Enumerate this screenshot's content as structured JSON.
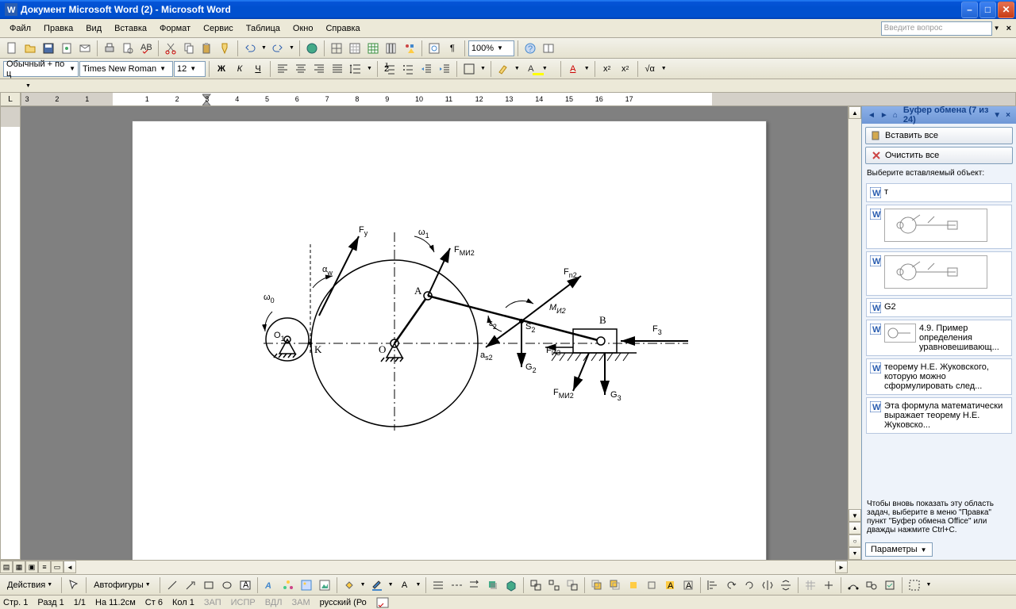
{
  "titlebar": {
    "title": "Документ Microsoft Word (2) - Microsoft Word"
  },
  "menu": {
    "file": "Файл",
    "edit": "Правка",
    "view": "Вид",
    "insert": "Вставка",
    "format": "Формат",
    "tools": "Сервис",
    "table": "Таблица",
    "window": "Окно",
    "help": "Справка",
    "ask_placeholder": "Введите вопрос"
  },
  "toolbar1": {
    "zoom": "100%"
  },
  "toolbar2": {
    "style": "Обычный + по ц",
    "font": "Times New Roman",
    "size": "12"
  },
  "taskpane": {
    "title": "Буфер обмена (7 из 24)",
    "paste_all": "Вставить все",
    "clear_all": "Очистить все",
    "choose_label": "Выберите вставляемый объект:",
    "items": [
      {
        "type": "text",
        "text": "т"
      },
      {
        "type": "thumb"
      },
      {
        "type": "thumb"
      },
      {
        "type": "text",
        "text": "G2"
      },
      {
        "type": "text_thumb",
        "text": "4.9. Пример определения уравновешивающ..."
      },
      {
        "type": "text",
        "text": "теорему Н.Е. Жуковского, которую можно сформулировать след..."
      },
      {
        "type": "text",
        "text": "Эта формула математически выражает теорему Н.Е. Жуковско..."
      }
    ],
    "footer_text": "Чтобы вновь показать эту область задач, выберите в меню \"Правка\" пункт \"Буфер обмена Office\" или дважды нажмите Ctrl+C.",
    "options": "Параметры"
  },
  "drawbar": {
    "actions": "Действия",
    "autoshapes": "Автофигуры"
  },
  "statusbar": {
    "page": "Стр. 1",
    "section": "Разд 1",
    "pages": "1/1",
    "at": "На 11.2см",
    "line": "Ст 6",
    "col": "Кол 1",
    "rec": "ЗАП",
    "trk": "ИСПР",
    "ext": "ВДЛ",
    "ovr": "ЗАМ",
    "lang": "русский (Ро"
  },
  "ruler": {
    "marks": [
      "3",
      "2",
      "1",
      "",
      "1",
      "2",
      "3",
      "4",
      "5",
      "6",
      "7",
      "8",
      "9",
      "10",
      "11",
      "12",
      "13",
      "14",
      "15",
      "16",
      "17"
    ]
  },
  "diagram": {
    "labels": {
      "Fy": "F",
      "Fy_sub": "y",
      "omega1": "ω",
      "omega1_sub": "1",
      "FMI2_top": "F",
      "FMI2_top_sub": "MИ2",
      "alpha_w": "α",
      "alpha_w_sub": "w",
      "omega0": "ω",
      "omega0_sub": "0",
      "A": "A",
      "Fn2": "F",
      "Fn2_sub": "n2",
      "MI2": "M",
      "MI2_sub": "И2",
      "MI2_italic": true,
      "O1": "O",
      "O1_sub": "1",
      "K": "K",
      "O": "O",
      "S2": "S",
      "S2_sub": "2",
      "eps2": "ε",
      "eps2_sub": "2",
      "B": "B",
      "F3": "F",
      "F3_sub": "3",
      "FI3": "F",
      "FI3_sub": "И3",
      "as2": "a",
      "as2_sub": "s2",
      "G2": "G",
      "G2_sub": "2",
      "FMI2_bot": "F",
      "FMI2_bot_sub": "MИ2",
      "G3": "G",
      "G3_sub": "3"
    }
  }
}
